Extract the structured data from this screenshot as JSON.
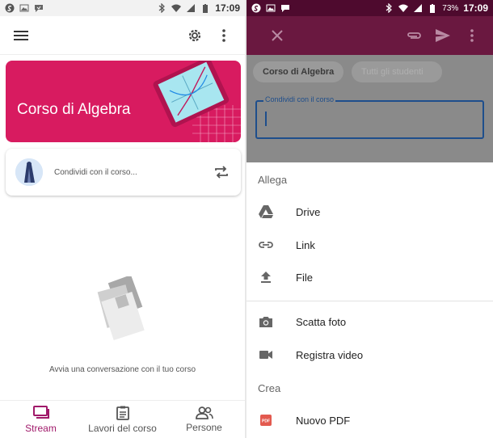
{
  "left": {
    "status": {
      "time": "17:09"
    },
    "course_title": "Corso di Algebra",
    "share_placeholder": "Condividi con il corso...",
    "empty_message": "Avvia una conversazione con il tuo corso",
    "bottom_nav": [
      {
        "label": "Stream",
        "icon": "stream-icon",
        "active": true
      },
      {
        "label": "Lavori del corso",
        "icon": "classwork-icon",
        "active": false
      },
      {
        "label": "Persone",
        "icon": "people-icon",
        "active": false
      }
    ],
    "colors": {
      "banner": "#d81b60",
      "accent": "#a0196a"
    }
  },
  "right": {
    "status": {
      "battery": "73%",
      "time": "17:09"
    },
    "chips": {
      "course": "Corso di Algebra",
      "students": "Tutti gli studenti"
    },
    "share_field_label": "Condividi con il corso",
    "attach_title": "Allega",
    "attach_items": [
      {
        "label": "Drive",
        "icon": "drive-icon"
      },
      {
        "label": "Link",
        "icon": "link-icon"
      },
      {
        "label": "File",
        "icon": "upload-icon"
      }
    ],
    "capture_items": [
      {
        "label": "Scatta foto",
        "icon": "camera-icon"
      },
      {
        "label": "Registra video",
        "icon": "videocam-icon"
      }
    ],
    "create_title": "Crea",
    "create_items": [
      {
        "label": "Nuovo PDF",
        "icon": "pdf-icon"
      }
    ],
    "colors": {
      "appbar": "#6a1840",
      "statusbar": "#4e0a2e",
      "field": "#1e4e8c"
    }
  }
}
